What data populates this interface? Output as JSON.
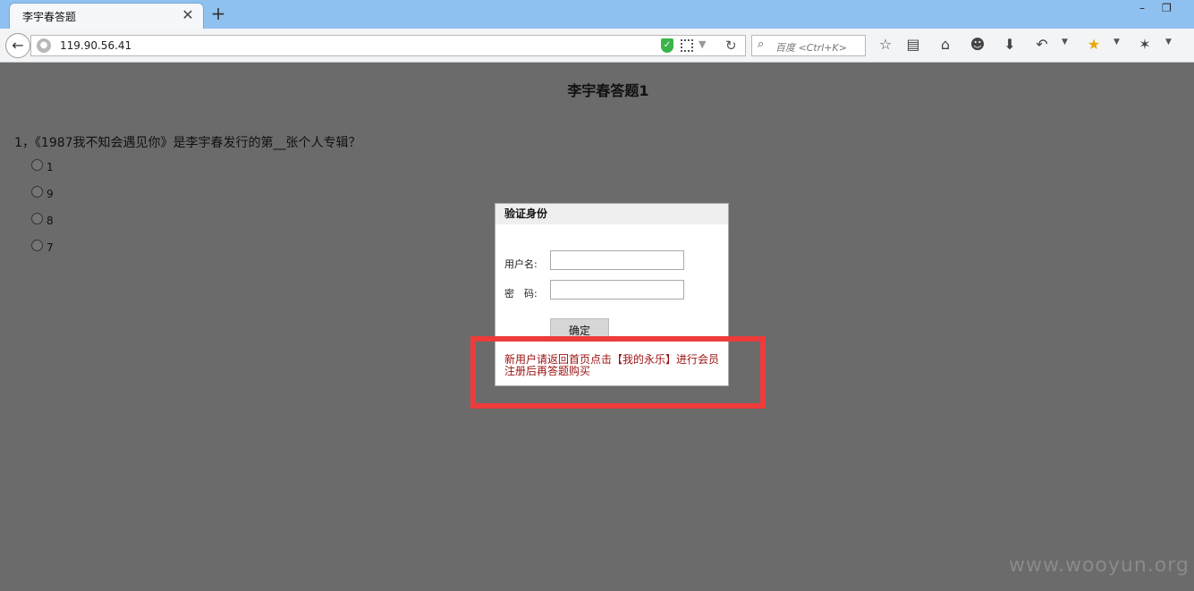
{
  "browser": {
    "tab_title": "李宇春答题",
    "tab_close": "✕",
    "new_tab": "+",
    "url": "119.90.56.41",
    "search_placeholder": "百度 <Ctrl+K>"
  },
  "page": {
    "title": "李宇春答题1",
    "question": "1，《1987我不知会遇见你》是李宇春发行的第__张个人专辑？",
    "options": [
      "1",
      "9",
      "8",
      "7"
    ]
  },
  "modal": {
    "title": "验证身份",
    "username_label": "用户名:",
    "password_label": "密　码:",
    "username_value": "",
    "password_value": "",
    "confirm_label": "确定",
    "notice_line1": "新用户请返回首页点击【我的永乐】进行会员",
    "notice_line2": "注册后再答题购买"
  },
  "watermark": "www.wooyun.org",
  "colors": {
    "overlay": "#6b6b6b",
    "tabstrip": "#8fc1f0",
    "highlight": "#ee3b3b",
    "notice_text": "#9b1010"
  }
}
